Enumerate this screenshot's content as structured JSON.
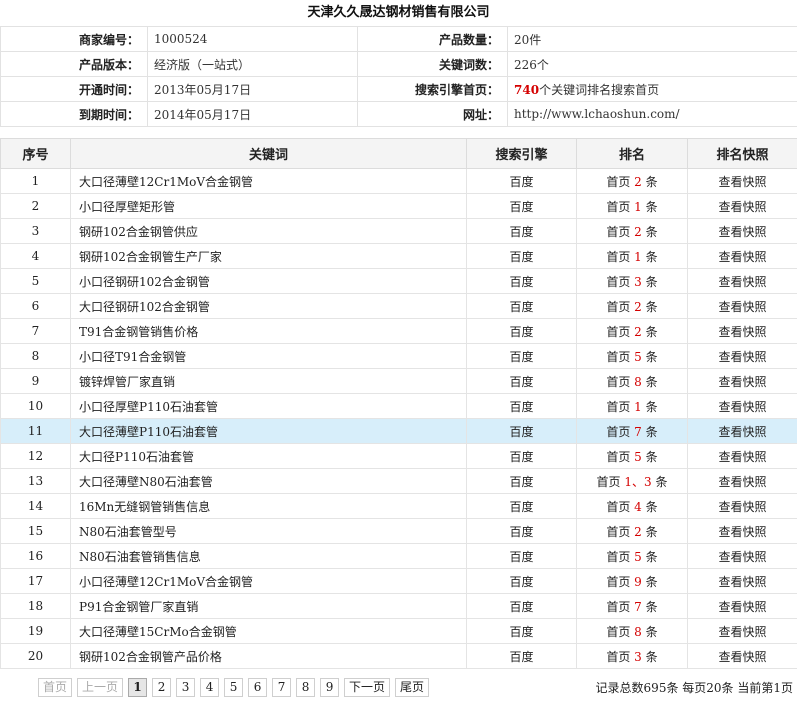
{
  "company_title": "天津久久晟达钢材销售有限公司",
  "info": {
    "merchant_id_label": "商家编号：",
    "merchant_id": "1000524",
    "product_count_label": "产品数量：",
    "product_count": "20件",
    "version_label": "产品版本：",
    "version": "经济版（一站式）",
    "keyword_count_label": "关键词数：",
    "keyword_count": "226个",
    "open_time_label": "开通时间：",
    "open_time": "2013年05月17日",
    "search_first_label": "搜索引擎首页：",
    "search_first_num": "740",
    "search_first_text": "个关键词排名搜索首页",
    "expire_label": "到期时间：",
    "expire_time": "2014年05月17日",
    "website_label": "网址：",
    "website": "http://www.lchaoshun.com/"
  },
  "table": {
    "headers": [
      "序号",
      "关键词",
      "搜索引擎",
      "排名",
      "排名快照"
    ],
    "rows": [
      {
        "no": "1",
        "keyword": "大口径薄壁12Cr1MoV合金钢管",
        "engine": "百度",
        "rank_prefix": "首页",
        "rank_num": "2",
        "rank_suffix": "条",
        "snapshot": "查看快照"
      },
      {
        "no": "2",
        "keyword": "小口径厚壁矩形管",
        "engine": "百度",
        "rank_prefix": "首页",
        "rank_num": "1",
        "rank_suffix": "条",
        "snapshot": "查看快照"
      },
      {
        "no": "3",
        "keyword": "钢研102合金钢管供应",
        "engine": "百度",
        "rank_prefix": "首页",
        "rank_num": "2",
        "rank_suffix": "条",
        "snapshot": "查看快照"
      },
      {
        "no": "4",
        "keyword": "钢研102合金钢管生产厂家",
        "engine": "百度",
        "rank_prefix": "首页",
        "rank_num": "1",
        "rank_suffix": "条",
        "snapshot": "查看快照"
      },
      {
        "no": "5",
        "keyword": "小口径钢研102合金钢管",
        "engine": "百度",
        "rank_prefix": "首页",
        "rank_num": "3",
        "rank_suffix": "条",
        "snapshot": "查看快照"
      },
      {
        "no": "6",
        "keyword": "大口径钢研102合金钢管",
        "engine": "百度",
        "rank_prefix": "首页",
        "rank_num": "2",
        "rank_suffix": "条",
        "snapshot": "查看快照"
      },
      {
        "no": "7",
        "keyword": "T91合金钢管销售价格",
        "engine": "百度",
        "rank_prefix": "首页",
        "rank_num": "2",
        "rank_suffix": "条",
        "snapshot": "查看快照"
      },
      {
        "no": "8",
        "keyword": "小口径T91合金钢管",
        "engine": "百度",
        "rank_prefix": "首页",
        "rank_num": "5",
        "rank_suffix": "条",
        "snapshot": "查看快照"
      },
      {
        "no": "9",
        "keyword": "镀锌焊管厂家直销",
        "engine": "百度",
        "rank_prefix": "首页",
        "rank_num": "8",
        "rank_suffix": "条",
        "snapshot": "查看快照"
      },
      {
        "no": "10",
        "keyword": "小口径厚壁P110石油套管",
        "engine": "百度",
        "rank_prefix": "首页",
        "rank_num": "1",
        "rank_suffix": "条",
        "snapshot": "查看快照"
      },
      {
        "no": "11",
        "keyword": "大口径薄壁P110石油套管",
        "engine": "百度",
        "rank_prefix": "首页",
        "rank_num": "7",
        "rank_suffix": "条",
        "snapshot": "查看快照"
      },
      {
        "no": "12",
        "keyword": "大口径P110石油套管",
        "engine": "百度",
        "rank_prefix": "首页",
        "rank_num": "5",
        "rank_suffix": "条",
        "snapshot": "查看快照"
      },
      {
        "no": "13",
        "keyword": "大口径薄壁N80石油套管",
        "engine": "百度",
        "rank_prefix": "首页",
        "rank_num": "1、3",
        "rank_suffix": "条",
        "snapshot": "查看快照"
      },
      {
        "no": "14",
        "keyword": "16Mn无缝钢管销售信息",
        "engine": "百度",
        "rank_prefix": "首页",
        "rank_num": "4",
        "rank_suffix": "条",
        "snapshot": "查看快照"
      },
      {
        "no": "15",
        "keyword": "N80石油套管型号",
        "engine": "百度",
        "rank_prefix": "首页",
        "rank_num": "2",
        "rank_suffix": "条",
        "snapshot": "查看快照"
      },
      {
        "no": "16",
        "keyword": "N80石油套管销售信息",
        "engine": "百度",
        "rank_prefix": "首页",
        "rank_num": "5",
        "rank_suffix": "条",
        "snapshot": "查看快照"
      },
      {
        "no": "17",
        "keyword": "小口径薄壁12Cr1MoV合金钢管",
        "engine": "百度",
        "rank_prefix": "首页",
        "rank_num": "9",
        "rank_suffix": "条",
        "snapshot": "查看快照"
      },
      {
        "no": "18",
        "keyword": "P91合金钢管厂家直销",
        "engine": "百度",
        "rank_prefix": "首页",
        "rank_num": "7",
        "rank_suffix": "条",
        "snapshot": "查看快照"
      },
      {
        "no": "19",
        "keyword": "大口径薄壁15CrMo合金钢管",
        "engine": "百度",
        "rank_prefix": "首页",
        "rank_num": "8",
        "rank_suffix": "条",
        "snapshot": "查看快照"
      },
      {
        "no": "20",
        "keyword": "钢研102合金钢管产品价格",
        "engine": "百度",
        "rank_prefix": "首页",
        "rank_num": "3",
        "rank_suffix": "条",
        "snapshot": "查看快照"
      }
    ]
  },
  "pagination": {
    "first": "首页",
    "prev": "上一页",
    "pages": [
      "1",
      "2",
      "3",
      "4",
      "5",
      "6",
      "7",
      "8",
      "9"
    ],
    "current": "1",
    "next": "下一页",
    "last": "尾页"
  },
  "summary": "记录总数695条 每页20条 当前第1页",
  "colors": {
    "highlight_row": "#d7eefa",
    "rank_number": "#d40000",
    "header_bg": "#f4f4f4"
  }
}
